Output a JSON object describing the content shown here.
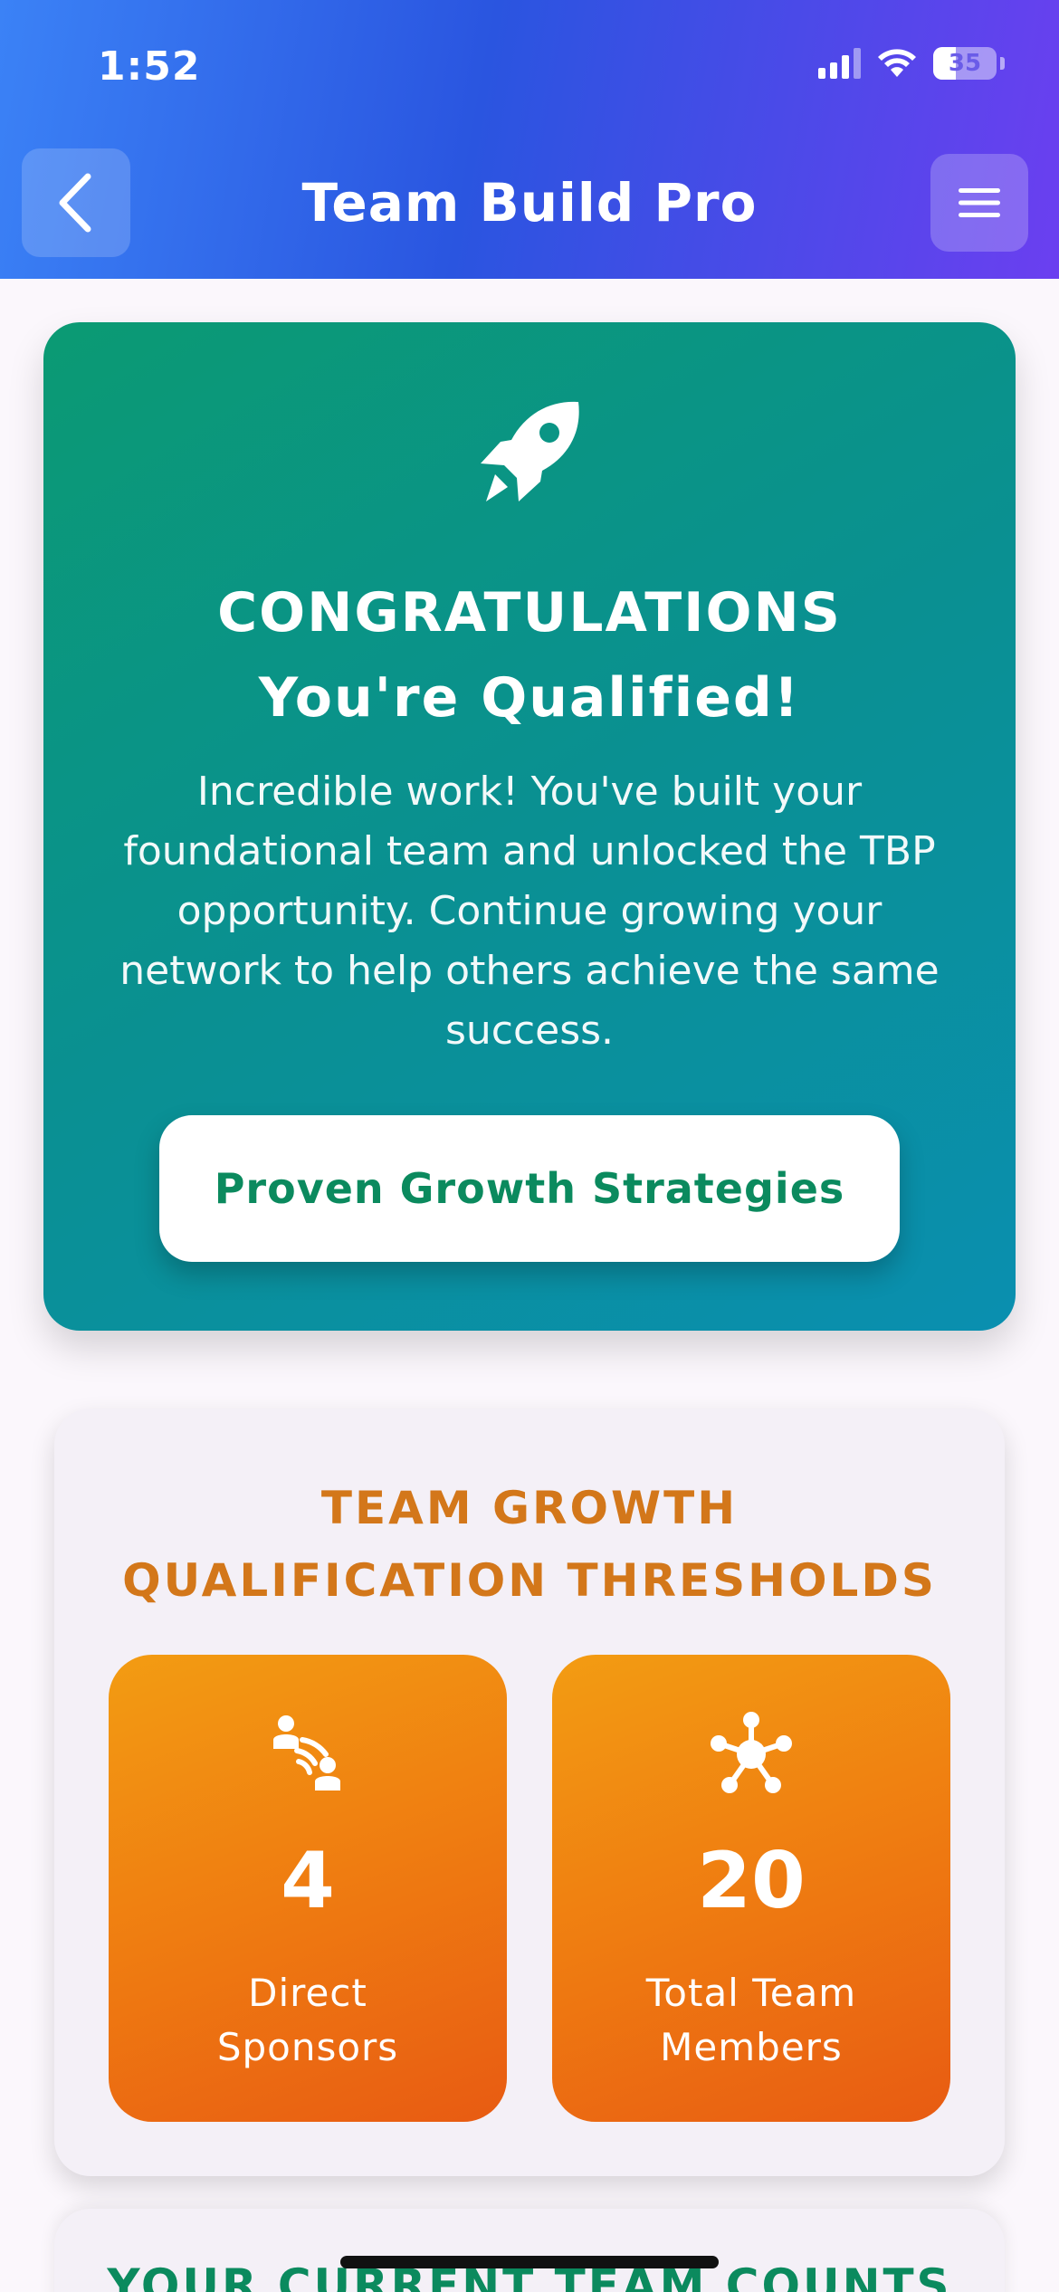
{
  "status_bar": {
    "time": "1:52",
    "battery": "35"
  },
  "header": {
    "title": "Team Build Pro",
    "back_icon": "chevron-left-icon",
    "menu_icon": "hamburger-menu-icon",
    "gradient": [
      "#3b82f6",
      "#2a55e0",
      "#6b3ff0"
    ]
  },
  "congrats": {
    "icon": "rocket-icon",
    "title_line1": "CONGRATULATIONS",
    "title_line2": "You're Qualified!",
    "body": "Incredible work! You've built your foundational team and unlocked the TBP opportunity. Continue growing your network to help others achieve the same success.",
    "button_label": "Proven Growth Strategies",
    "colors": {
      "start": "#0b9a73",
      "end": "#0a8fb0",
      "button_text": "#0b8a5e"
    }
  },
  "thresholds": {
    "title_line1": "TEAM GROWTH",
    "title_line2": "QUALIFICATION THRESHOLDS",
    "title_color": "#d3771a",
    "tiles": [
      {
        "icon": "connect-people-icon",
        "value": "4",
        "label_line1": "Direct",
        "label_line2": "Sponsors"
      },
      {
        "icon": "network-hub-icon",
        "value": "20",
        "label_line1": "Total Team",
        "label_line2": "Members"
      }
    ]
  },
  "current_counts": {
    "title": "YOUR CURRENT TEAM COUNTS"
  }
}
